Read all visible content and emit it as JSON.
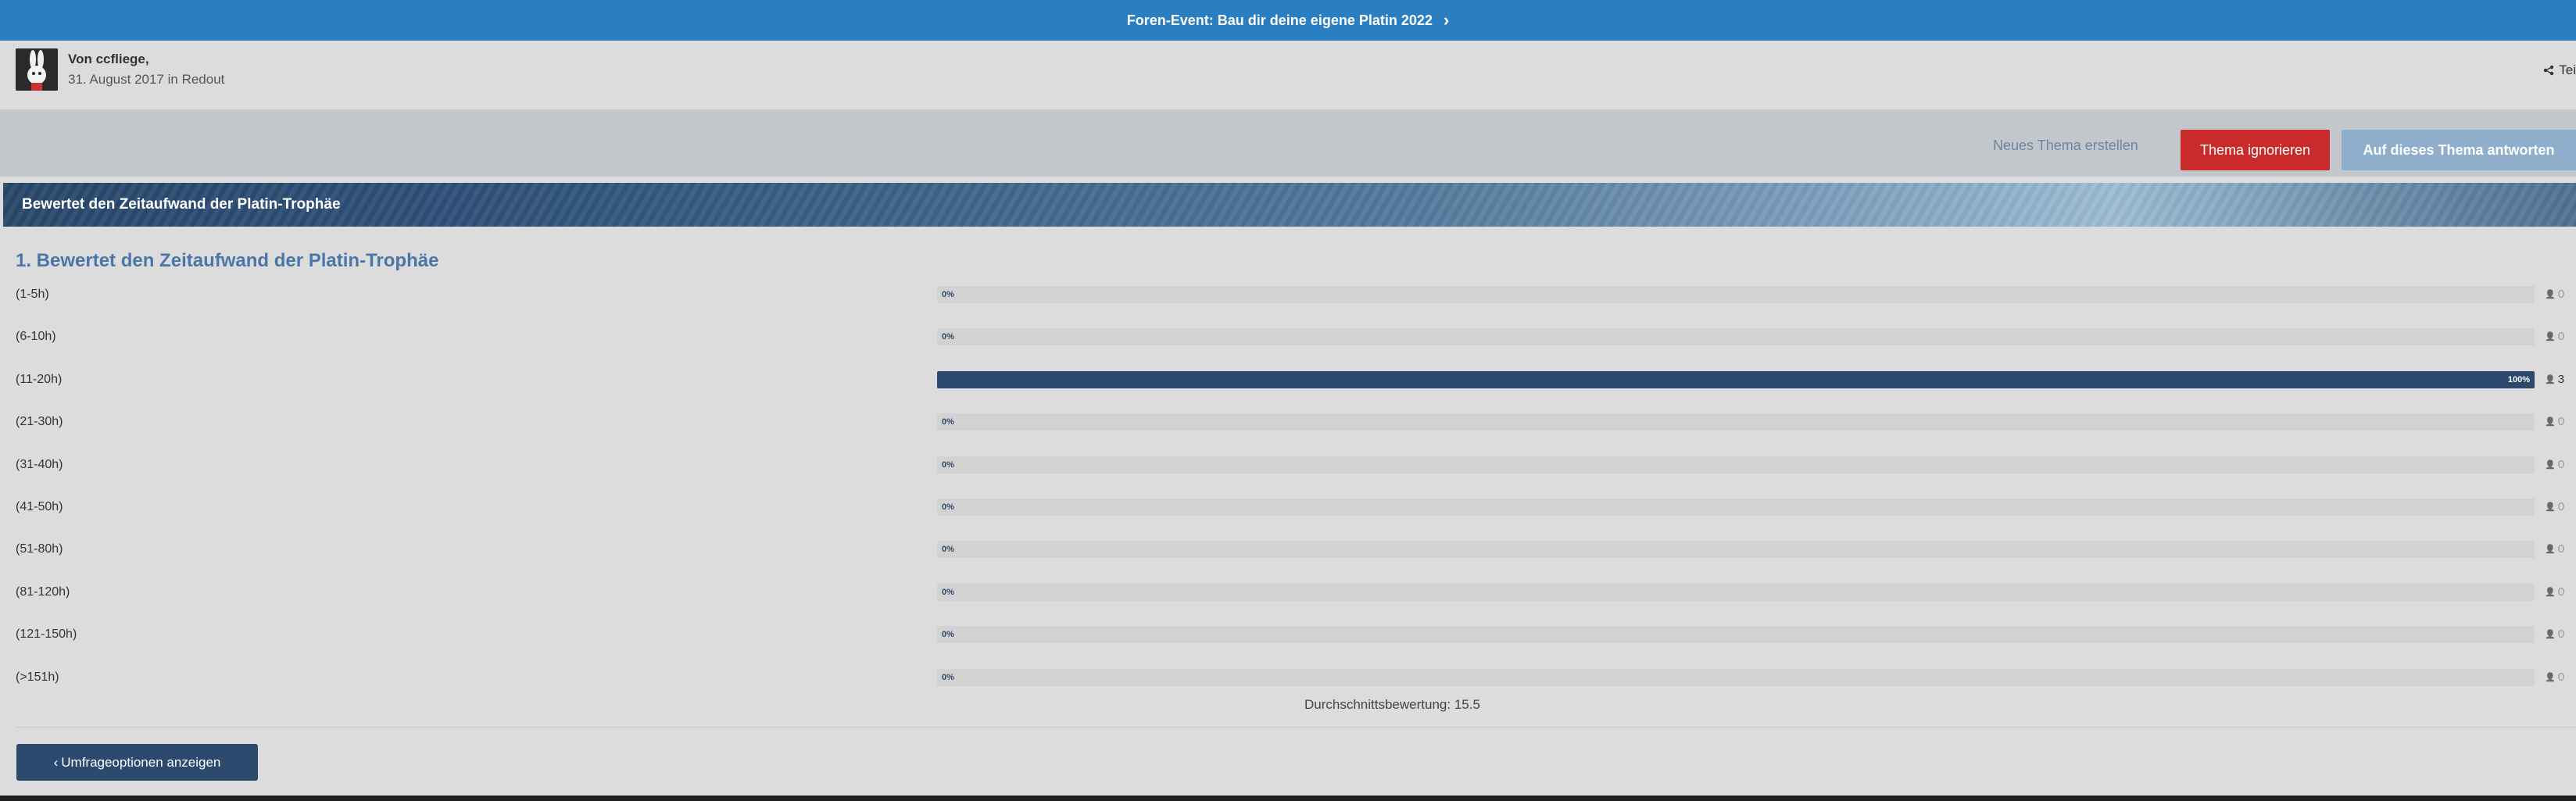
{
  "topbar": {
    "text": "Foren-Event: Bau dir deine eigene Platin 2022",
    "chevron": "chevron-right-icon"
  },
  "author": {
    "by_prefix": "Von ",
    "name": "ccfliege,",
    "date": "31. August 2017 in Redout",
    "share_label": "Tei"
  },
  "actions": {
    "new_topic": "Neues Thema erstellen",
    "ignore": "Thema ignorieren",
    "reply": "Auf dieses Thema antworten"
  },
  "banner": {
    "title": "Bewertet den Zeitaufwand der Platin-Trophäe"
  },
  "poll": {
    "question": "1. Bewertet den Zeitaufwand der Platin-Trophäe",
    "options": [
      {
        "label": "(1-5h)",
        "percent": 0,
        "percent_text": "0%",
        "votes": "0"
      },
      {
        "label": "(6-10h)",
        "percent": 0,
        "percent_text": "0%",
        "votes": "0"
      },
      {
        "label": "(11-20h)",
        "percent": 100,
        "percent_text": "100%",
        "votes": "3"
      },
      {
        "label": "(21-30h)",
        "percent": 0,
        "percent_text": "0%",
        "votes": "0"
      },
      {
        "label": "(31-40h)",
        "percent": 0,
        "percent_text": "0%",
        "votes": "0"
      },
      {
        "label": "(41-50h)",
        "percent": 0,
        "percent_text": "0%",
        "votes": "0"
      },
      {
        "label": "(51-80h)",
        "percent": 0,
        "percent_text": "0%",
        "votes": "0"
      },
      {
        "label": "(81-120h)",
        "percent": 0,
        "percent_text": "0%",
        "votes": "0"
      },
      {
        "label": "(121-150h)",
        "percent": 0,
        "percent_text": "0%",
        "votes": "0"
      },
      {
        "label": "(>151h)",
        "percent": 0,
        "percent_text": "0%",
        "votes": "0"
      }
    ],
    "average": "Durchschnittsbewertung: 15.5",
    "options_button": "Umfrageoptionen anzeigen"
  },
  "colors": {
    "accent": "#2a7fc2",
    "bar": "#2c4a6e",
    "danger": "#c92a2a",
    "reply": "#8eaecb"
  }
}
